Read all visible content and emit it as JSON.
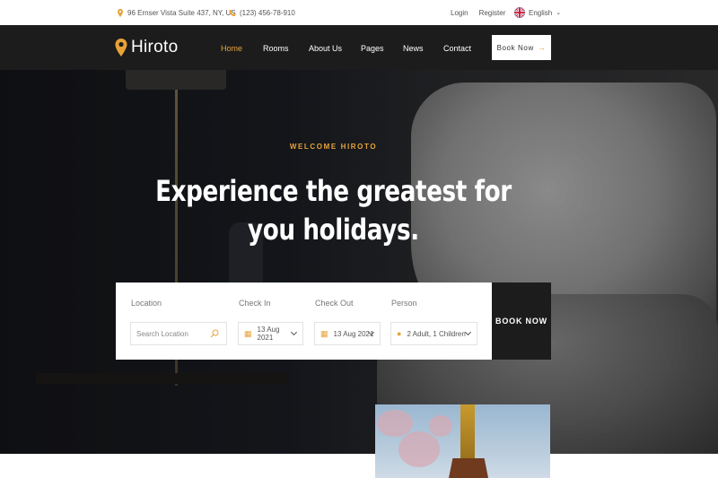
{
  "topbar": {
    "address": "96 Ernser Vista Suite 437, NY, US",
    "phone": "(123) 456-78-910",
    "login": "Login",
    "register": "Register",
    "language": "English"
  },
  "nav": {
    "logo": "Hiroto",
    "items": [
      "Home",
      "Rooms",
      "About Us",
      "Pages",
      "News",
      "Contact"
    ],
    "active": "Home",
    "book_button": "Book Now",
    "book_arrow": "→"
  },
  "hero": {
    "eyebrow": "WELCOME HIROTO",
    "headline_line1": "Experience the greatest for",
    "headline_line2": "you holidays."
  },
  "booking": {
    "location_label": "Location",
    "location_placeholder": "Search Location",
    "checkin_label": "Check In",
    "checkin_value": "13 Aug 2021",
    "checkout_label": "Check Out",
    "checkout_value": "13 Aug 2021",
    "person_label": "Person",
    "person_value": "2 Adult, 1 Children",
    "submit": "BOOK NOW"
  },
  "icons": {
    "address": "map-pin-icon",
    "phone": "phone-icon",
    "language": "uk-flag-icon",
    "calendar": "calendar-icon",
    "person": "people-icon",
    "search": "search-icon"
  },
  "colors": {
    "accent": "#e7a338",
    "dark": "#1c1c1c"
  }
}
